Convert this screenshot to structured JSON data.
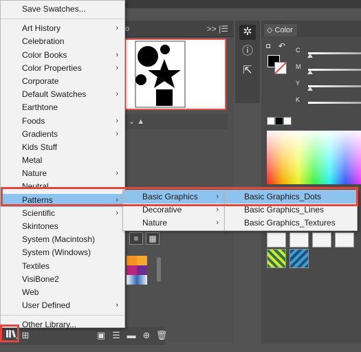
{
  "colors": {
    "menu_bg": "#f2f2f2",
    "highlight": "#8dc3ee",
    "callout_red": "#e2473d",
    "app_bg": "#535353"
  },
  "main_menu": {
    "top_item": "Save Swatches...",
    "items": [
      {
        "label": "Art History",
        "submenu": true
      },
      {
        "label": "Celebration",
        "submenu": false
      },
      {
        "label": "Color Books",
        "submenu": true
      },
      {
        "label": "Color Properties",
        "submenu": true
      },
      {
        "label": "Corporate",
        "submenu": false
      },
      {
        "label": "Default Swatches",
        "submenu": true
      },
      {
        "label": "Earthtone",
        "submenu": false
      },
      {
        "label": "Foods",
        "submenu": true
      },
      {
        "label": "Gradients",
        "submenu": true
      },
      {
        "label": "Kids Stuff",
        "submenu": false
      },
      {
        "label": "Metal",
        "submenu": false
      },
      {
        "label": "Nature",
        "submenu": true
      },
      {
        "label": "Neutral",
        "submenu": false
      },
      {
        "label": "Patterns",
        "submenu": true
      },
      {
        "label": "Scientific",
        "submenu": true
      },
      {
        "label": "Skintones",
        "submenu": false
      },
      {
        "label": "System (Macintosh)",
        "submenu": false
      },
      {
        "label": "System (Windows)",
        "submenu": false
      },
      {
        "label": "Textiles",
        "submenu": false
      },
      {
        "label": "VisiBone2",
        "submenu": false
      },
      {
        "label": "Web",
        "submenu": false
      },
      {
        "label": "User Defined",
        "submenu": true
      }
    ],
    "bottom_item": "Other Library..."
  },
  "patterns_submenu": {
    "items": [
      {
        "label": "Basic Graphics",
        "submenu": true
      },
      {
        "label": "Decorative",
        "submenu": true
      },
      {
        "label": "Nature",
        "submenu": true
      }
    ]
  },
  "basic_graphics_submenu": {
    "items": [
      {
        "label": "Basic Graphics_Dots"
      },
      {
        "label": "Basic Graphics_Lines"
      },
      {
        "label": "Basic Graphics_Textures"
      }
    ]
  },
  "background": {
    "mid_panel_tab": "fo",
    "mid_panel_controls": ">> |☰",
    "color_panel_title": "◇ Color",
    "sliders": [
      "C",
      "M",
      "Y",
      "K"
    ]
  },
  "icons": {
    "library_button": "swatch-libraries-icon",
    "arrow": "chevron-right-icon"
  }
}
